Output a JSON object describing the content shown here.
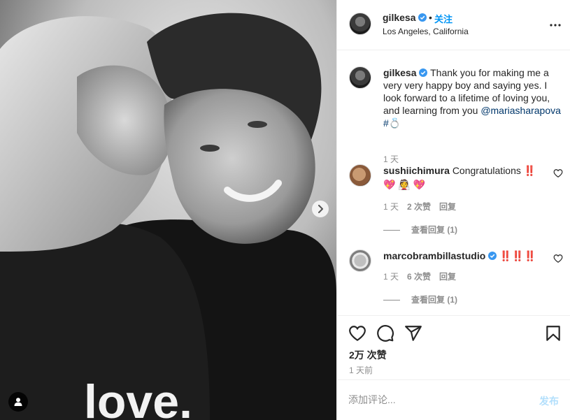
{
  "post": {
    "username": "gilkesa",
    "separator": "•",
    "follow_label": "关注",
    "location": "Los Angeles, California"
  },
  "caption": {
    "username": "gilkesa",
    "text": "Thank you for making me a very very happy boy and saying yes. I look forward to a lifetime of loving you, and learning from you",
    "mention": "@mariasharapova",
    "hashtag": "#💍",
    "time": "1 天"
  },
  "comments": [
    {
      "username": "sushiichimura",
      "text": "Congratulations ‼️",
      "emoji": "💖 👰 💖",
      "time": "1 天",
      "likes": "2 次赞",
      "reply": "回复",
      "view_replies": "查看回复 (1)"
    },
    {
      "username": "marcobrambillastudio",
      "text": "‼️‼️‼️",
      "time": "1 天",
      "likes": "6 次赞",
      "reply": "回复",
      "view_replies": "查看回复 (1)"
    }
  ],
  "stats": {
    "likes": "2万 次赞",
    "posted": "1 天前"
  },
  "add_comment": {
    "placeholder": "添加评论...",
    "post_label": "发布"
  },
  "photo": {
    "shirt_text": "love."
  },
  "colors": {
    "link_blue": "#0095f6",
    "verified_blue": "#3897f0",
    "mention": "#00376b",
    "muted": "#8e8e8e"
  }
}
